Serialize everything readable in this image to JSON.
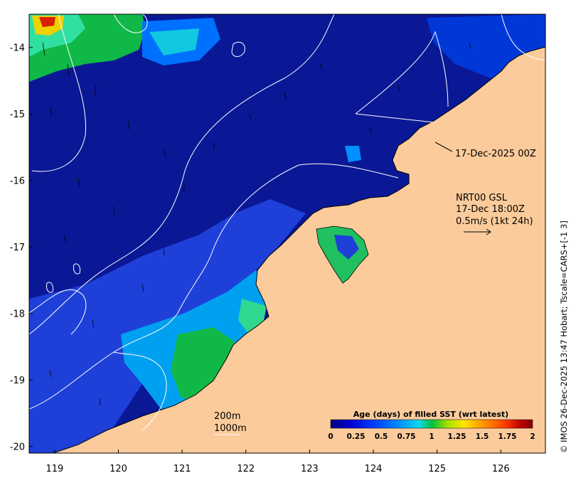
{
  "map": {
    "x_ticks": [
      "119",
      "120",
      "121",
      "122",
      "123",
      "124",
      "125",
      "126"
    ],
    "y_ticks": [
      "-14",
      "-15",
      "-16",
      "-17",
      "-18",
      "-19",
      "-20"
    ],
    "xlim": [
      118.6,
      126.7
    ],
    "ylim": [
      -20.1,
      -13.5
    ],
    "colors": {
      "ocean": "#0a1896",
      "land": "#fccb9b",
      "contour": "#ffffff",
      "frame": "#000000"
    }
  },
  "annotations": {
    "timestamp": "17-Dec-2025 00Z",
    "model_name": "NRT00 GSL",
    "model_time": "17-Dec 18:00Z",
    "scale_text": "0.5m/s (1kt 24h)",
    "contour_200": "200m",
    "contour_1000": "1000m"
  },
  "colorbar": {
    "title": "Age (days) of filled SST (wrt latest)",
    "ticks": [
      "0",
      "0.25",
      "0.5",
      "0.75",
      "1",
      "1.25",
      "1.5",
      "1.75",
      "2"
    ],
    "colors": [
      "#00007f",
      "#0000d4",
      "#0040ff",
      "#0090ff",
      "#10d8e8",
      "#50ffa8",
      "#00c040",
      "#a8e000",
      "#ffe600",
      "#ff9800",
      "#ff4000",
      "#c00000",
      "#7f0000"
    ]
  },
  "credit": "© IMOS 26-Dec-2025 13:47 Hobart; Tscale=CARS+[-1 3]"
}
